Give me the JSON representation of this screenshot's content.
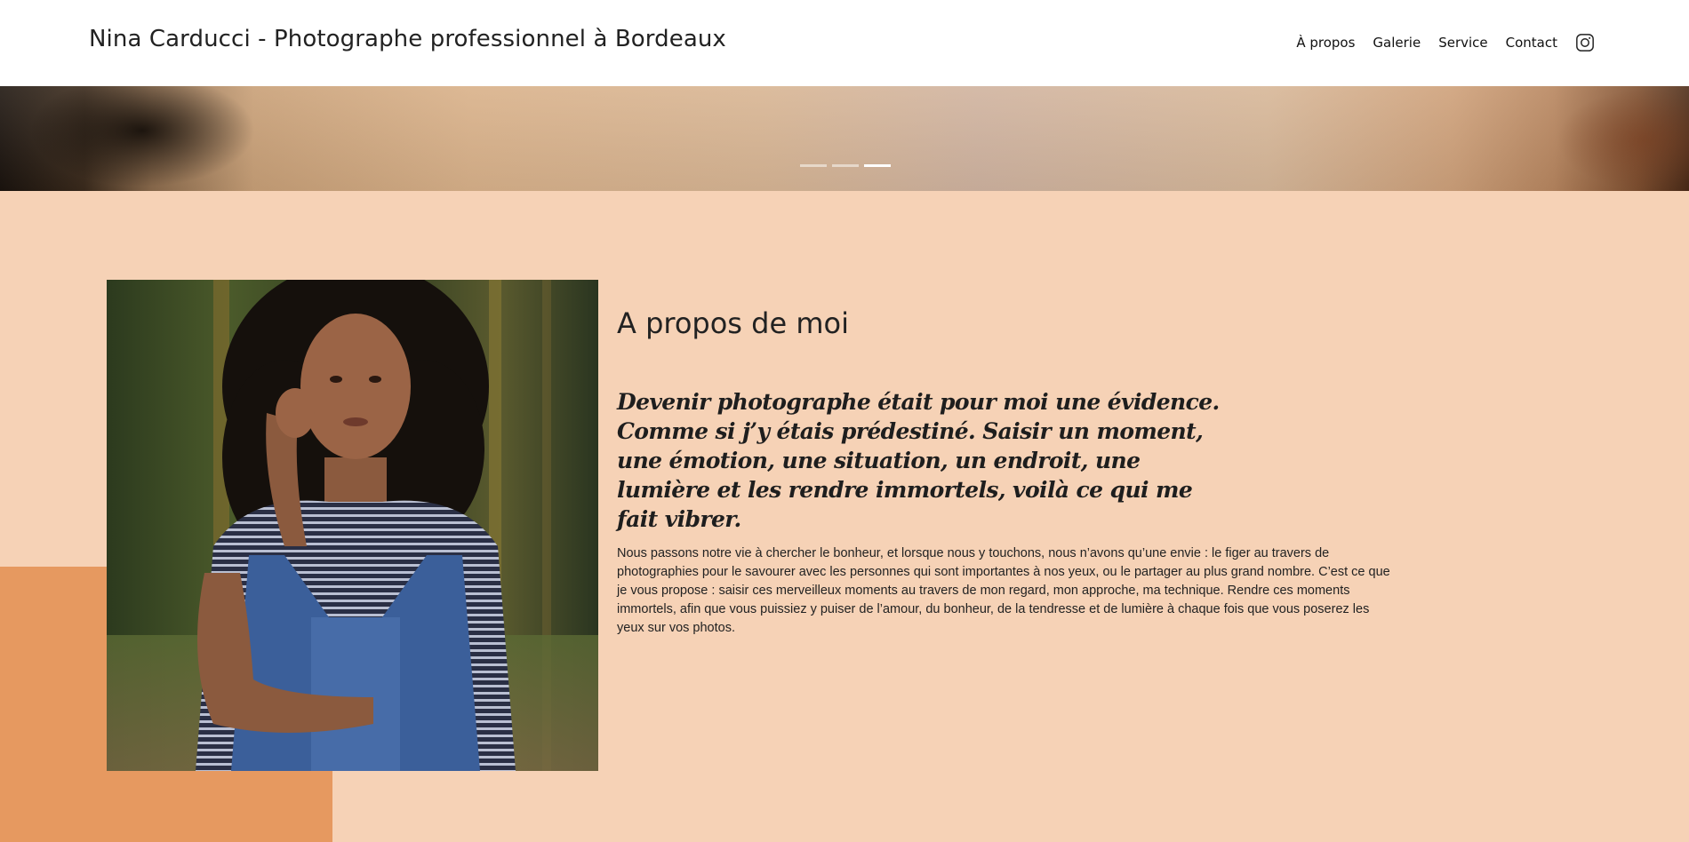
{
  "header": {
    "site_title": "Nina Carducci - Photographe professionnel à Bordeaux",
    "nav": [
      {
        "label": "À propos"
      },
      {
        "label": "Galerie"
      },
      {
        "label": "Service"
      },
      {
        "label": "Contact"
      }
    ],
    "social_icon": "instagram-icon"
  },
  "carousel": {
    "slide_count": 3,
    "active_index": 2
  },
  "about": {
    "heading": "A propos de moi",
    "quote": "Devenir photographe était pour moi une évidence. Comme si j’y étais prédestiné. Saisir un moment, une émotion, une situation, un endroit, une lumière et les rendre immortels, voilà ce qui me fait vibrer.",
    "body": "Nous passons notre vie à chercher le bonheur, et lorsque nous y touchons, nous n’avons qu’une envie : le figer au travers de photographies pour le savourer avec les personnes qui sont importantes à nos yeux, ou le partager au plus grand nombre. C’est ce que je vous propose : saisir ces merveilleux moments au travers de mon regard, mon approche, ma technique. Rendre ces moments immortels, afin que vous puissiez y puiser de l’amour, du bonheur, de la tendresse et de lumière à chaque fois que vous poserez les yeux sur vos photos."
  },
  "colors": {
    "header_background": "#ffffff",
    "section_background": "#f6d2b6",
    "accent_block": "#e69960",
    "text": "#222222"
  }
}
